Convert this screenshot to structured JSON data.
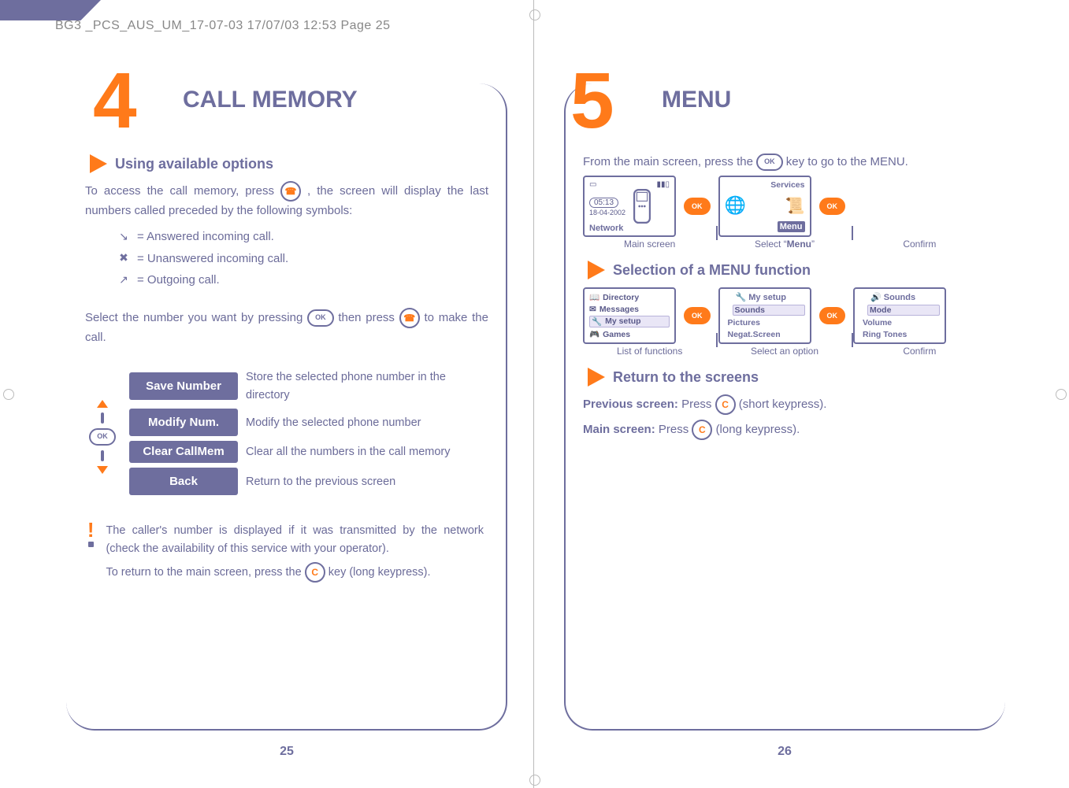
{
  "doc_header": "BG3 _PCS_AUS_UM_17-07-03  17/07/03  12:53  Page 25",
  "left": {
    "chapter_num": "4",
    "chapter_title": "CALL MEMORY",
    "section1": "Using available options",
    "intro_a": "To access the call memory, press ",
    "intro_b": ", the screen will display the last numbers called preceded by the following symbols:",
    "legend": {
      "answered": "=  Answered incoming call.",
      "unanswered": "=  Unanswered incoming call.",
      "outgoing": "=  Outgoing call."
    },
    "select_a": "Select the number you want by pressing ",
    "select_b": " then press ",
    "select_c": " to make the call.",
    "options": [
      {
        "label": "Save Number",
        "desc": "Store the selected phone number in the directory"
      },
      {
        "label": "Modify Num.",
        "desc": "Modify the selected phone number"
      },
      {
        "label": "Clear CallMem",
        "desc": "Clear all the numbers in the call memory"
      },
      {
        "label": "Back",
        "desc": "Return to the previous screen"
      }
    ],
    "tip_a": "The caller's number is displayed if it was transmitted by the network (check the availability of this service with your operator).",
    "tip_b_pre": "To return to the main screen, press the ",
    "tip_b_post": " key (long keypress).",
    "page_num": "25"
  },
  "right": {
    "chapter_num": "5",
    "chapter_title": "MENU",
    "intro_a": "From the main screen, press the ",
    "intro_b": " key to go to the MENU.",
    "flow1": {
      "panel_a": {
        "time": "05:13",
        "date": "18-04-2002",
        "network": "Network"
      },
      "panel_b": {
        "services": "Services",
        "menu": "Menu"
      },
      "cap_a": "Main screen",
      "cap_b_pre": "Select “",
      "cap_b_bold": "Menu",
      "cap_b_post": "”",
      "cap_c": "Confirm"
    },
    "section2": "Selection of a MENU function",
    "flow2": {
      "panel_a": {
        "items": [
          "Directory",
          "Messages",
          "My setup",
          "Games"
        ]
      },
      "panel_b": {
        "title": "My setup",
        "items": [
          "Sounds",
          "Pictures",
          "Negat.Screen"
        ]
      },
      "panel_c": {
        "title": "Sounds",
        "items": [
          "Mode",
          "Volume",
          "Ring Tones"
        ]
      },
      "cap_a": "List of functions",
      "cap_b": "Select an option",
      "cap_c": "Confirm"
    },
    "section3": "Return to the screens",
    "prev_label": "Previous screen:",
    "prev_a": "  Press ",
    "prev_b": " (short keypress).",
    "main_label": "Main screen:",
    "main_a": "  Press ",
    "main_b": " (long keypress).",
    "page_num": "26",
    "keys": {
      "ok": "OK",
      "c": "C",
      "call": "☎"
    }
  }
}
